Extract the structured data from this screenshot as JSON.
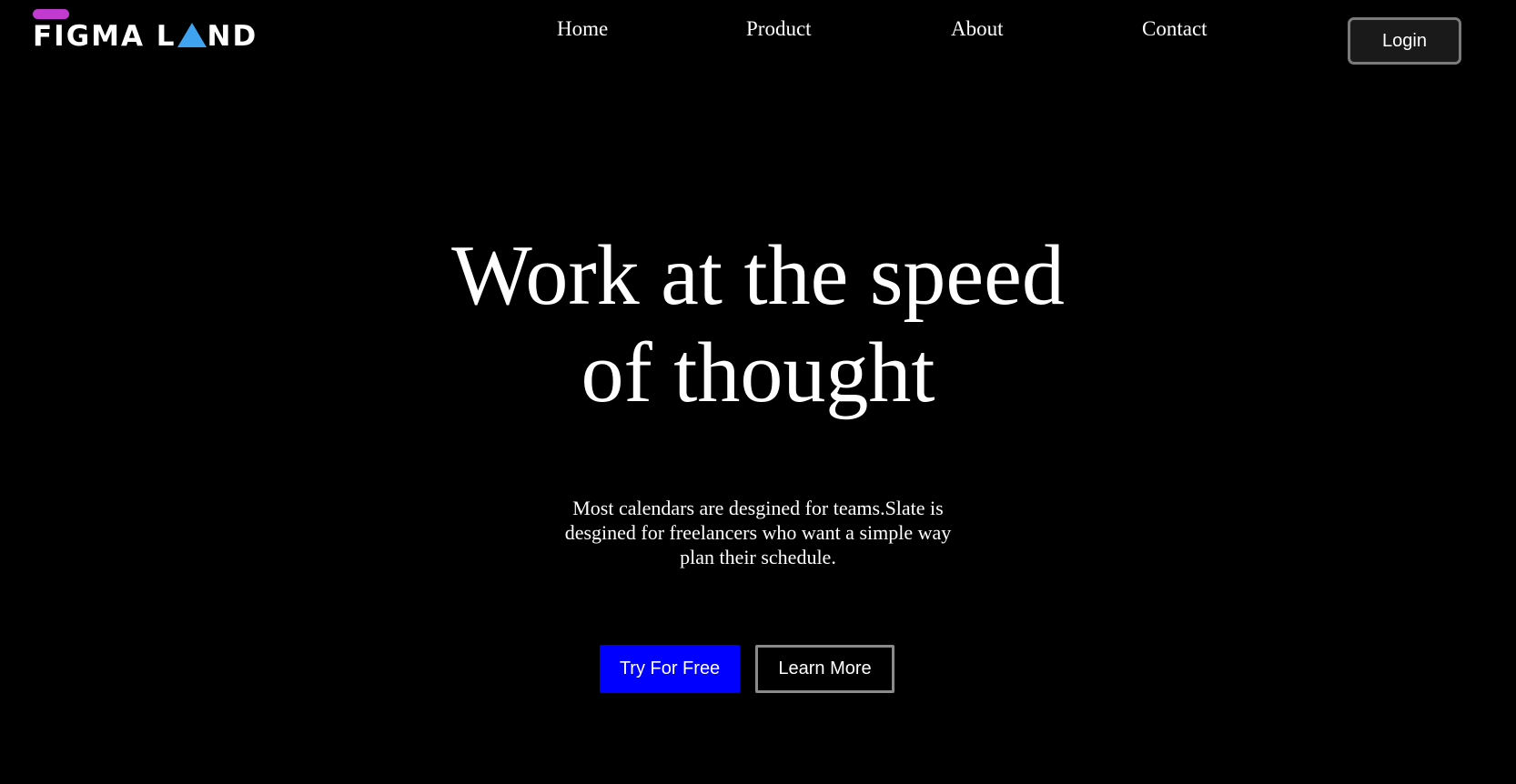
{
  "brand": {
    "logo_text_before": "FIGMA L",
    "logo_text_after": "ND",
    "logo_pill_color": "#c13bd1",
    "logo_triangle_color": "#3fa3f0"
  },
  "nav": {
    "items": [
      {
        "label": "Home"
      },
      {
        "label": "Product"
      },
      {
        "label": "About"
      },
      {
        "label": "Contact"
      }
    ],
    "login_label": "Login"
  },
  "hero": {
    "headline_line1": "Work at the speed",
    "headline_line2": "of thought",
    "description_line1": "Most calendars are desgined for teams.Slate is",
    "description_line2": "desgined for freelancers who want a simple way",
    "description_line3": "plan their schedule.",
    "primary_cta": "Try For Free",
    "secondary_cta": "Learn More"
  },
  "colors": {
    "background": "#000000",
    "primary_button": "#0000ff",
    "text": "#ffffff"
  }
}
